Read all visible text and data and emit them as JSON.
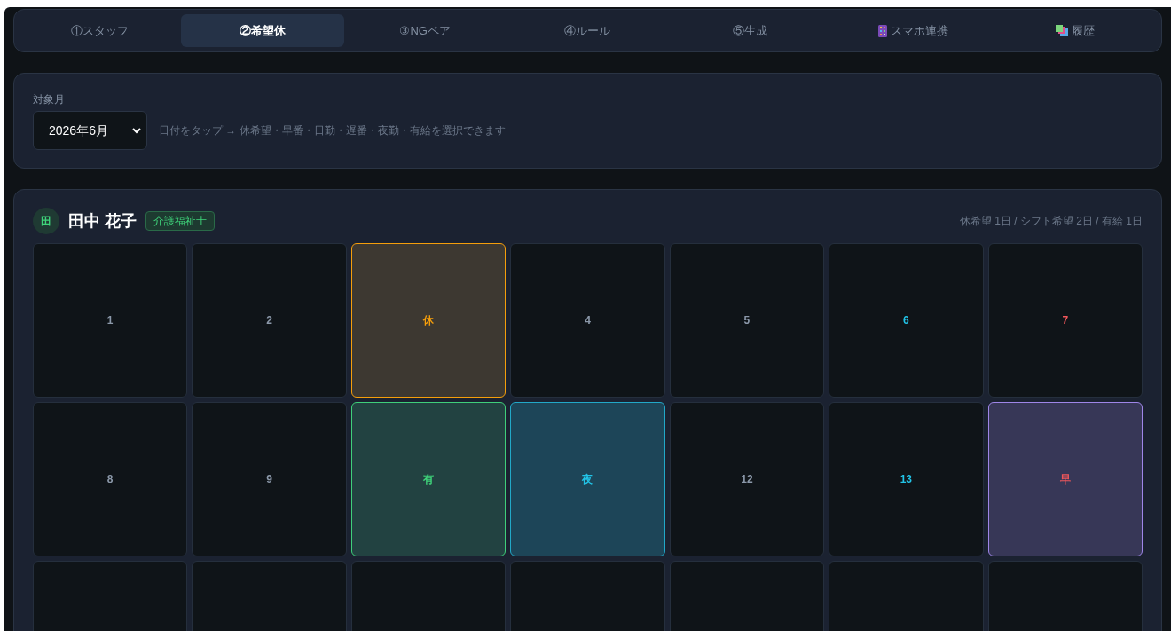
{
  "tabs": [
    {
      "label": "①スタッフ",
      "selected": false
    },
    {
      "label": "②希望休",
      "selected": true
    },
    {
      "label": "③NGペア",
      "selected": false
    },
    {
      "label": "④ルール",
      "selected": false
    },
    {
      "label": "⑤生成",
      "selected": false
    },
    {
      "label": "スマホ連携",
      "selected": false,
      "kind": "phone"
    },
    {
      "label": "履歴",
      "selected": false,
      "kind": "cards"
    }
  ],
  "month_panel": {
    "label": "対象月",
    "month_select": "2026年6月",
    "hint": "日付をタップ → 休希望・早番・日勤・遅番・夜勤・有給を選択できます"
  },
  "staff": {
    "avatar": "田",
    "name": "田中 花子",
    "role": "介護福祉士",
    "summary": "休希望 1日 / シフト希望 2日 / 有給 1日",
    "cells": [
      {
        "label": "1",
        "kind": "day",
        "color": "#8b98a9"
      },
      {
        "label": "2",
        "kind": "day",
        "color": "#8b98a9"
      },
      {
        "label": "休",
        "kind": "off",
        "color": "#f59e0b"
      },
      {
        "label": "4",
        "kind": "day",
        "color": "#8b98a9"
      },
      {
        "label": "5",
        "kind": "day",
        "color": "#8b98a9"
      },
      {
        "label": "6",
        "kind": "day",
        "color": "#22c3e6"
      },
      {
        "label": "7",
        "kind": "day",
        "color": "#f0575b"
      },
      {
        "label": "8",
        "kind": "day",
        "color": "#8b98a9"
      },
      {
        "label": "9",
        "kind": "day",
        "color": "#8b98a9"
      },
      {
        "label": "有",
        "kind": "paid",
        "color": "#3fd37a"
      },
      {
        "label": "夜",
        "kind": "night",
        "color": "#22c3e6"
      },
      {
        "label": "12",
        "kind": "day",
        "color": "#8b98a9"
      },
      {
        "label": "13",
        "kind": "day",
        "color": "#22c3e6"
      },
      {
        "label": "早",
        "kind": "early",
        "color": "#f0575b"
      },
      {
        "kind": "day"
      },
      {
        "kind": "day"
      },
      {
        "kind": "day"
      },
      {
        "kind": "day"
      },
      {
        "kind": "day"
      },
      {
        "kind": "day"
      },
      {
        "kind": "day"
      }
    ]
  }
}
